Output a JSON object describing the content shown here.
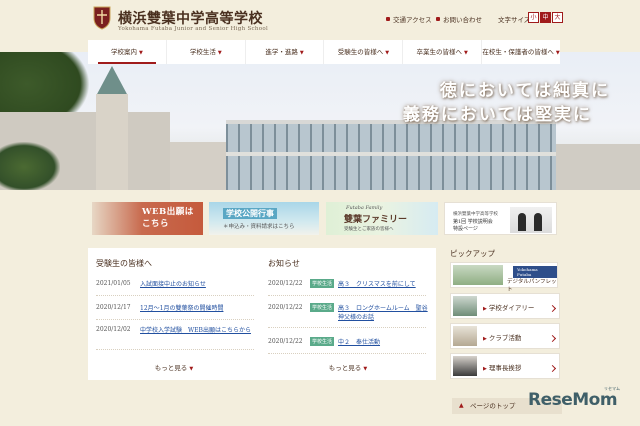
{
  "header": {
    "title": "横浜雙葉中学高等学校",
    "subtitle": "Yokohama Futaba Junior and Senior High School",
    "access_label": "交通アクセス",
    "contact_label": "お問い合わせ",
    "font_size_label": "文字サイズ",
    "font_sizes": [
      "小",
      "中",
      "大"
    ]
  },
  "nav": {
    "items": [
      "学校案内",
      "学校生活",
      "進学・進路",
      "受験生の皆様へ",
      "卒業生の皆様へ",
      "在校生・保護者の皆様へ"
    ]
  },
  "hero": {
    "motto_line1": "徳においては純真に",
    "motto_line2": "義務においては堅実に"
  },
  "banners": {
    "web_apply": "WEB出願は\nこちら",
    "school_event": "学校公開行事",
    "school_event_sub": "＊申込み・資料請求はこちら",
    "family_small": "Futaba Family",
    "family_title": "雙葉ファミリー",
    "family_sub": "受験生とご家族の皆様へ",
    "briefing_small": "横浜雙葉中学高等学校",
    "briefing_title": "第1回 学校説明会\n特設ページ"
  },
  "applicants_news": {
    "title": "受験生の皆様へ",
    "items": [
      {
        "date": "2021/01/05",
        "text": "入試面接中止のお知らせ"
      },
      {
        "date": "2020/12/17",
        "text": "12月～1月の雙葉祭の開催時間"
      },
      {
        "date": "2020/12/02",
        "text": "中学校入学試験　WEB出願はこちらから"
      }
    ],
    "more_label": "もっと見る"
  },
  "notices": {
    "title": "お知らせ",
    "tag_label": "学校生活",
    "items": [
      {
        "date": "2020/12/22",
        "text": "高３　クリスマスを前にして"
      },
      {
        "date": "2020/12/22",
        "text": "高３　ロングホームルーム　聖谷神父様のお話"
      },
      {
        "date": "2020/12/22",
        "text": "中２　奉仕活動"
      }
    ],
    "more_label": "もっと見る"
  },
  "pickup": {
    "title": "ピックアップ",
    "banner_logo": "Yokohama Futaba",
    "banner_text": "デジタルパンフレット",
    "links": [
      "学校ダイアリー",
      "クラブ活動",
      "理事長挨拶"
    ]
  },
  "footer": {
    "pagetop_label": "ページのトップ",
    "watermark": "ReseMom",
    "watermark_sub": "リセマム"
  },
  "colors": {
    "accent": "#a01b1b",
    "background": "#f3eedd",
    "tag": "#5aaa8a",
    "link": "#2250a0"
  }
}
